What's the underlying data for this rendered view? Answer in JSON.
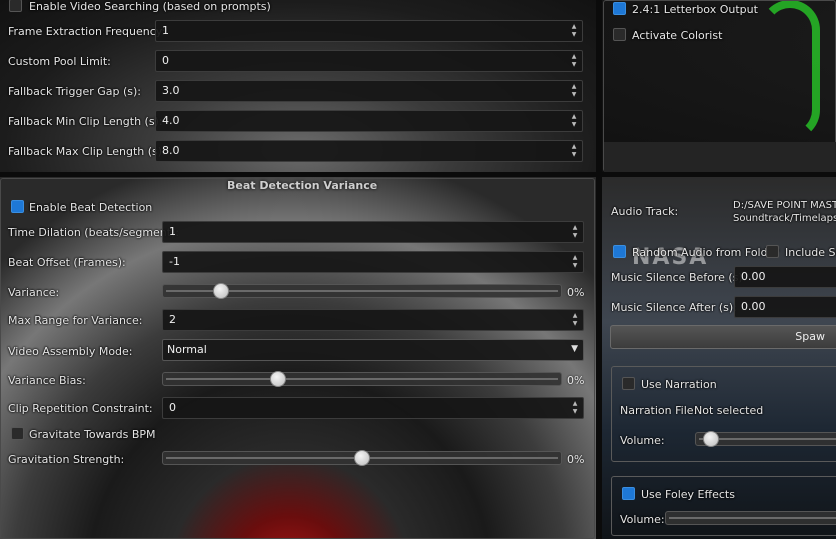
{
  "video_panel": {
    "enable_video_searching": {
      "label": "Enable Video Searching (based on prompts)",
      "checked": false
    },
    "frame_extraction_frequency": {
      "label": "Frame Extraction Frequency:",
      "value": "1"
    },
    "custom_pool_limit": {
      "label": "Custom Pool Limit:",
      "value": "0"
    },
    "fallback_trigger_gap": {
      "label": "Fallback Trigger Gap (s):",
      "value": "3.0"
    },
    "fallback_min_clip_length": {
      "label": "Fallback Min Clip Length (s):",
      "value": "4.0"
    },
    "fallback_max_clip_length": {
      "label": "Fallback Max Clip Length (s):",
      "value": "8.0"
    }
  },
  "output_panel": {
    "letterbox_output": {
      "label": "2.4:1 Letterbox Output",
      "checked": true
    },
    "activate_colorist": {
      "label": "Activate Colorist",
      "checked": false
    }
  },
  "beat_panel": {
    "title": "Beat Detection  Variance",
    "enable_beat_detection": {
      "label": "Enable Beat Detection",
      "checked": true
    },
    "time_dilation": {
      "label": "Time Dilation (beats/segment):",
      "value": "1"
    },
    "beat_offset": {
      "label": "Beat Offset (Frames):",
      "value": "-1"
    },
    "variance": {
      "label": "Variance:",
      "value_percent": 13,
      "display": "0%"
    },
    "max_range_for_variance": {
      "label": "Max Range for Variance:",
      "value": "2"
    },
    "video_assembly_mode": {
      "label": "Video Assembly Mode:",
      "selected": "Normal"
    },
    "variance_bias": {
      "label": "Variance Bias:",
      "value_percent": 28,
      "display": "0%"
    },
    "clip_repetition_constraint": {
      "label": "Clip Repetition Constraint:",
      "value": "0"
    },
    "gravitate_towards_bpm": {
      "label": "Gravitate Towards BPM",
      "checked": false
    },
    "gravitation_strength": {
      "label": "Gravitation Strength:",
      "value_percent": 50,
      "display": "0%"
    }
  },
  "audio_panel": {
    "audio_track": {
      "label": "Audio Track:",
      "path_line1": "D:/SAVE POINT MAST",
      "path_line2": "Soundtrack/Timelaps"
    },
    "random_audio_from_folder": {
      "label": "Random Audio from Folder",
      "checked": true
    },
    "include_sub": {
      "label": "Include Su",
      "checked": false
    },
    "music_silence_before": {
      "label": "Music Silence Before (s):",
      "value": "0.00"
    },
    "music_silence_after": {
      "label": "Music Silence After (s):",
      "value": "0.00"
    },
    "spawn_button": {
      "label": "Spaw"
    },
    "use_narration": {
      "label": "Use Narration",
      "checked": false
    },
    "narration_file": {
      "label": "Narration File:",
      "value": "Not selected"
    },
    "narration_volume": {
      "label": "Volume:",
      "value_percent": 5
    },
    "use_foley": {
      "label": "Use Foley Effects",
      "checked": true
    },
    "foley_volume": {
      "label": "Volume:"
    }
  },
  "background_text": {
    "logo": "NASA"
  },
  "colors": {
    "accent": "#1e78d6",
    "panel_bg": "#161616",
    "text": "#e6e6e6"
  }
}
